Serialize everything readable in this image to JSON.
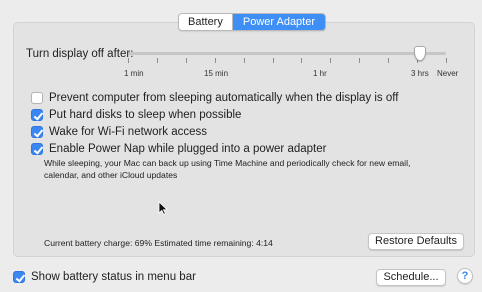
{
  "tabs": [
    {
      "label": "Battery",
      "selected": false
    },
    {
      "label": "Power Adapter",
      "selected": true
    }
  ],
  "display_sleep": {
    "label": "Turn display off after:",
    "value": "3 hrs",
    "tick_labels": [
      "1 min",
      "15 min",
      "1 hr",
      "3 hrs",
      "Never"
    ]
  },
  "options": [
    {
      "label": "Prevent computer from sleeping automatically when the display is off",
      "checked": false
    },
    {
      "label": "Put hard disks to sleep when possible",
      "checked": true
    },
    {
      "label": "Wake for Wi-Fi network access",
      "checked": true
    },
    {
      "label": "Enable Power Nap while plugged into a power adapter",
      "checked": true
    }
  ],
  "power_nap_description": "While sleeping, your Mac can back up using Time Machine and periodically check for new email, calendar, and other iCloud updates",
  "status": {
    "battery_charge": "Current battery charge: 69%",
    "time_remaining": "Estimated time remaining: 4:14"
  },
  "buttons": {
    "restore_defaults": "Restore Defaults",
    "schedule": "Schedule...",
    "help": "?"
  },
  "show_battery_status": {
    "label": "Show battery status in menu bar",
    "checked": true
  },
  "colors": {
    "accent": "#3d8ef5",
    "panel": "#e3e3e3",
    "window": "#ececec"
  },
  "icons": {
    "pointer": "arrow-cursor-icon"
  }
}
